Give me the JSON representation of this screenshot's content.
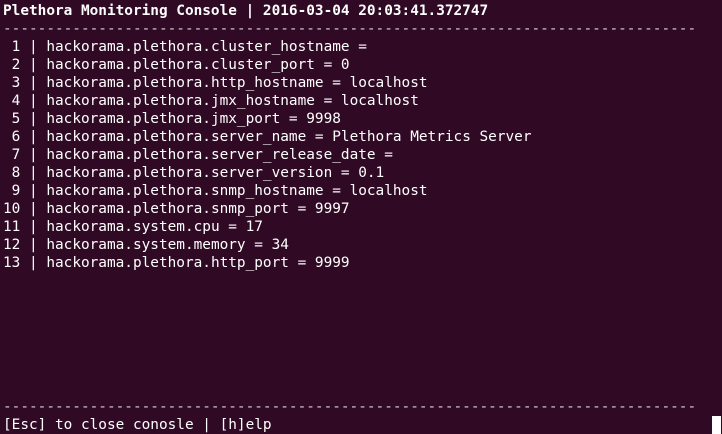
{
  "header": {
    "title": "Plethora Monitoring Console | 2016-03-04 20:03:41.372747",
    "separator": "--------------------------------------------------------------------------------"
  },
  "rows": [
    {
      "index": " 1",
      "text": "hackorama.plethora.cluster_hostname ="
    },
    {
      "index": " 2",
      "text": "hackorama.plethora.cluster_port = 0"
    },
    {
      "index": " 3",
      "text": "hackorama.plethora.http_hostname = localhost"
    },
    {
      "index": " 4",
      "text": "hackorama.plethora.jmx_hostname = localhost"
    },
    {
      "index": " 5",
      "text": "hackorama.plethora.jmx_port = 9998"
    },
    {
      "index": " 6",
      "text": "hackorama.plethora.server_name = Plethora Metrics Server"
    },
    {
      "index": " 7",
      "text": "hackorama.plethora.server_release_date ="
    },
    {
      "index": " 8",
      "text": "hackorama.plethora.server_version = 0.1"
    },
    {
      "index": " 9",
      "text": "hackorama.plethora.snmp_hostname = localhost"
    },
    {
      "index": "10",
      "text": "hackorama.plethora.snmp_port = 9997"
    },
    {
      "index": "11",
      "text": "hackorama.system.cpu = 17"
    },
    {
      "index": "12",
      "text": "hackorama.system.memory = 34"
    },
    {
      "index": "13",
      "text": "hackorama.plethora.http_port = 9999"
    }
  ],
  "footer": {
    "separator": "--------------------------------------------------------------------------------",
    "help_text": "[Esc] to close conosle | [h]elp"
  }
}
